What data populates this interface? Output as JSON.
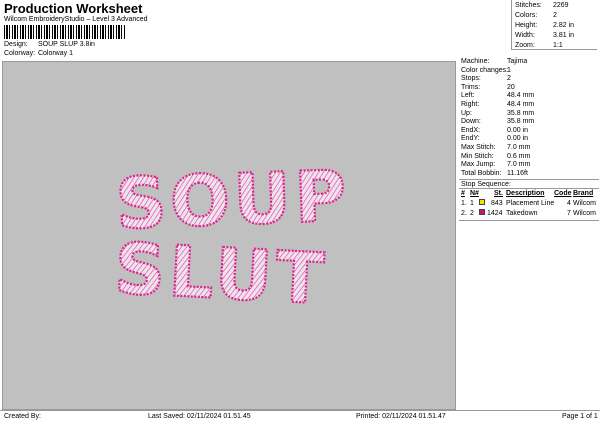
{
  "header": {
    "title": "Production Worksheet",
    "subtitle": "Wilcom EmbroideryStudio – Level 3 Advanced",
    "barcode_text": "",
    "design_label": "Design:",
    "design_value": "SOUP SLUP 3.8in",
    "colorway_label": "Colorway:",
    "colorway_value": "Colorway 1"
  },
  "stats": [
    {
      "label": "Stitches:",
      "value": "2269"
    },
    {
      "label": "Colors:",
      "value": "2"
    },
    {
      "label": "Height:",
      "value": "2.82 in"
    },
    {
      "label": "Width:",
      "value": "3.81 in"
    },
    {
      "label": "Zoom:",
      "value": "1:1"
    }
  ],
  "machine_info": [
    {
      "label": "Machine:",
      "value": "Tajima"
    },
    {
      "label": "Color changes:",
      "value": "1"
    },
    {
      "label": "Stops:",
      "value": "2"
    },
    {
      "label": "Trims:",
      "value": "20"
    },
    {
      "label": "Left:",
      "value": "48.4 mm"
    },
    {
      "label": "Right:",
      "value": "48.4 mm"
    },
    {
      "label": "Up:",
      "value": "35.8 mm"
    },
    {
      "label": "Down:",
      "value": "35.8 mm"
    },
    {
      "label": "EndX:",
      "value": "0.00 in"
    },
    {
      "label": "EndY:",
      "value": "0.00 in"
    },
    {
      "label": "Max Stitch:",
      "value": "7.0 mm"
    },
    {
      "label": "Min Stitch:",
      "value": "0.6 mm"
    },
    {
      "label": "Max Jump:",
      "value": "7.0 mm"
    },
    {
      "label": "Total Bobbin:",
      "value": "11.16ft"
    }
  ],
  "stop_sequence": {
    "title": "Stop Sequence:",
    "headers": {
      "num": "#",
      "n": "N#",
      "st": "St.",
      "description": "Description",
      "code": "Code",
      "brand": "Brand"
    },
    "rows": [
      {
        "num": "1.",
        "n": "1",
        "color": "#f2e600",
        "st": "843",
        "description": "Placement Line",
        "code": "4",
        "brand": "Wilcom"
      },
      {
        "num": "2.",
        "n": "2",
        "color": "#c2186b",
        "st": "1424",
        "description": "Takedown",
        "code": "7",
        "brand": "Wilcom"
      }
    ]
  },
  "design_art": {
    "line1": "SOUP",
    "line2": "SLUT",
    "outline_color": "#d9268a",
    "fill_color": "#e9e1ee",
    "stitch_color": "#e83a94"
  },
  "footer": {
    "created_by": "Created By:",
    "last_saved": "Last Saved: 02/11/2024 01.51.45",
    "printed": "Printed: 02/11/2024 01.51.47",
    "page": "Page 1 of 1"
  }
}
